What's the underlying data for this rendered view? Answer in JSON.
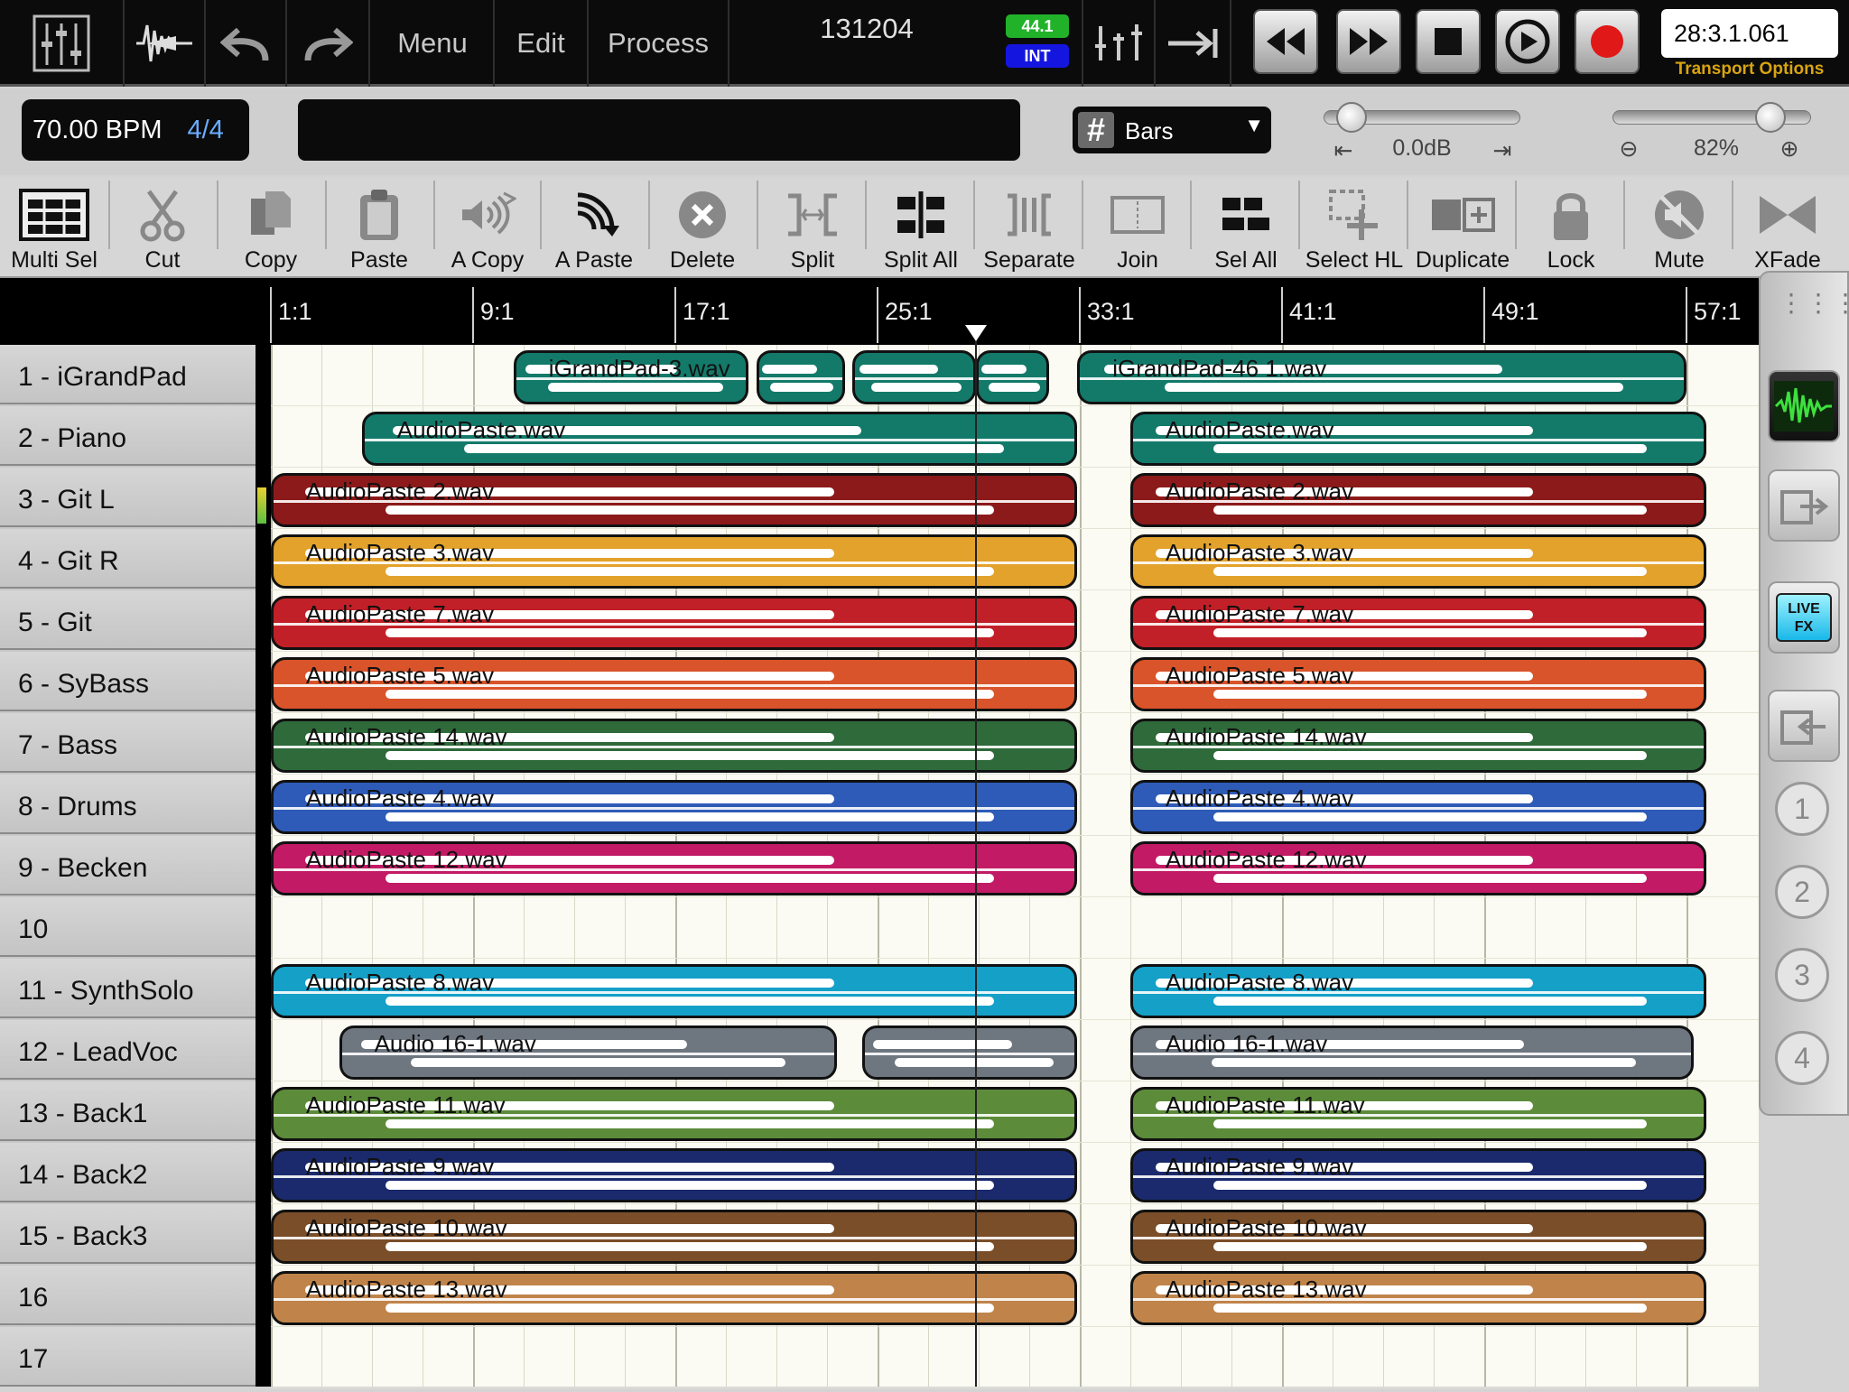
{
  "topbar": {
    "menus": [
      "Menu",
      "Edit",
      "Process"
    ],
    "project_name": "131204",
    "sample_rate": "44.1",
    "clock_source": "INT",
    "time_display": "28:3.1.061",
    "transport_options": "Transport Options",
    "icons": [
      "mixer-icon",
      "waveform-icon",
      "undo-icon",
      "redo-icon",
      "metronome-icon",
      "punch-icon",
      "rewind-icon",
      "fast-forward-icon",
      "stop-icon",
      "loop-icon",
      "record-icon"
    ],
    "record_color": "#e01818"
  },
  "secondbar": {
    "tempo": "70.00 BPM",
    "time_signature": "4/4",
    "grid_mode": "Bars",
    "volume": "0.0dB",
    "zoom": "82%"
  },
  "toolbar": [
    {
      "label": "Multi Sel",
      "icon": "multi-select-icon"
    },
    {
      "label": "Cut",
      "icon": "scissors-icon"
    },
    {
      "label": "Copy",
      "icon": "copy-icon"
    },
    {
      "label": "Paste",
      "icon": "clipboard-icon"
    },
    {
      "label": "A Copy",
      "icon": "audio-copy-icon"
    },
    {
      "label": "A Paste",
      "icon": "audio-paste-icon"
    },
    {
      "label": "Delete",
      "icon": "delete-icon"
    },
    {
      "label": "Split",
      "icon": "split-icon"
    },
    {
      "label": "Split All",
      "icon": "split-all-icon"
    },
    {
      "label": "Separate",
      "icon": "separate-icon"
    },
    {
      "label": "Join",
      "icon": "join-icon"
    },
    {
      "label": "Sel All",
      "icon": "select-all-icon"
    },
    {
      "label": "Select HL",
      "icon": "select-hl-icon"
    },
    {
      "label": "Duplicate",
      "icon": "duplicate-icon"
    },
    {
      "label": "Lock",
      "icon": "lock-icon"
    },
    {
      "label": "Mute",
      "icon": "mute-icon"
    },
    {
      "label": "XFade",
      "icon": "crossfade-icon"
    }
  ],
  "ruler": [
    "1:1",
    "9:1",
    "17:1",
    "25:1",
    "33:1",
    "41:1",
    "49:1",
    "57:1"
  ],
  "tracks": [
    "1 - iGrandPad",
    "2 - Piano",
    "3 - Git L",
    "4 - Git R",
    "5 - Git",
    "6 - SyBass",
    "7 - Bass",
    "8 - Drums",
    "9 - Becken",
    "10",
    "11 - SynthSolo",
    "12 - LeadVoc",
    "13 - Back1",
    "14 - Back2",
    "15 - Back3",
    "16",
    "17"
  ],
  "clips": [
    {
      "track": 0,
      "start_bar": 10.6,
      "end_bar": 19.9,
      "name": "iGrandPad-3.wav",
      "color": "#137a6a"
    },
    {
      "track": 0,
      "start_bar": 20.2,
      "end_bar": 23.7,
      "name": "",
      "color": "#137a6a"
    },
    {
      "track": 0,
      "start_bar": 24.0,
      "end_bar": 28.9,
      "name": "",
      "color": "#137a6a"
    },
    {
      "track": 0,
      "start_bar": 28.9,
      "end_bar": 31.8,
      "name": "",
      "color": "#137a6a"
    },
    {
      "track": 0,
      "start_bar": 32.9,
      "end_bar": 57.0,
      "name": "iGrandPad-46 1.wav",
      "color": "#137a6a"
    },
    {
      "track": 1,
      "start_bar": 4.6,
      "end_bar": 32.9,
      "name": "AudioPaste.wav",
      "color": "#137a6a"
    },
    {
      "track": 1,
      "start_bar": 35.0,
      "end_bar": 57.8,
      "name": "AudioPaste.wav",
      "color": "#137a6a"
    },
    {
      "track": 2,
      "start_bar": 1.0,
      "end_bar": 32.9,
      "name": "AudioPaste 2.wav",
      "color": "#8c1a1a"
    },
    {
      "track": 2,
      "start_bar": 35.0,
      "end_bar": 57.8,
      "name": "AudioPaste 2.wav",
      "color": "#8c1a1a"
    },
    {
      "track": 3,
      "start_bar": 1.0,
      "end_bar": 32.9,
      "name": "AudioPaste 3.wav",
      "color": "#e2a22c"
    },
    {
      "track": 3,
      "start_bar": 35.0,
      "end_bar": 57.8,
      "name": "AudioPaste 3.wav",
      "color": "#e2a22c"
    },
    {
      "track": 4,
      "start_bar": 1.0,
      "end_bar": 32.9,
      "name": "AudioPaste 7.wav",
      "color": "#c22028"
    },
    {
      "track": 4,
      "start_bar": 35.0,
      "end_bar": 57.8,
      "name": "AudioPaste 7.wav",
      "color": "#c22028"
    },
    {
      "track": 5,
      "start_bar": 1.0,
      "end_bar": 32.9,
      "name": "AudioPaste 5.wav",
      "color": "#d9542a"
    },
    {
      "track": 5,
      "start_bar": 35.0,
      "end_bar": 57.8,
      "name": "AudioPaste 5.wav",
      "color": "#d9542a"
    },
    {
      "track": 6,
      "start_bar": 1.0,
      "end_bar": 32.9,
      "name": "AudioPaste 14.wav",
      "color": "#2e6a3a"
    },
    {
      "track": 6,
      "start_bar": 35.0,
      "end_bar": 57.8,
      "name": "AudioPaste 14.wav",
      "color": "#2e6a3a"
    },
    {
      "track": 7,
      "start_bar": 1.0,
      "end_bar": 32.9,
      "name": "AudioPaste 4.wav",
      "color": "#2e5bb8"
    },
    {
      "track": 7,
      "start_bar": 35.0,
      "end_bar": 57.8,
      "name": "AudioPaste 4.wav",
      "color": "#2e5bb8"
    },
    {
      "track": 8,
      "start_bar": 1.0,
      "end_bar": 32.9,
      "name": "AudioPaste 12.wav",
      "color": "#c21a64"
    },
    {
      "track": 8,
      "start_bar": 35.0,
      "end_bar": 57.8,
      "name": "AudioPaste 12.wav",
      "color": "#c21a64"
    },
    {
      "track": 10,
      "start_bar": 1.0,
      "end_bar": 32.9,
      "name": "AudioPaste 8.wav",
      "color": "#15a0c8"
    },
    {
      "track": 10,
      "start_bar": 35.0,
      "end_bar": 57.8,
      "name": "AudioPaste 8.wav",
      "color": "#15a0c8"
    },
    {
      "track": 11,
      "start_bar": 3.7,
      "end_bar": 23.4,
      "name": "Audio 16-1.wav",
      "color": "#6e7680"
    },
    {
      "track": 11,
      "start_bar": 24.4,
      "end_bar": 32.9,
      "name": "",
      "color": "#6e7680"
    },
    {
      "track": 11,
      "start_bar": 35.0,
      "end_bar": 57.3,
      "name": "Audio 16-1.wav",
      "color": "#6e7680"
    },
    {
      "track": 12,
      "start_bar": 1.0,
      "end_bar": 32.9,
      "name": "AudioPaste 11.wav",
      "color": "#5c8c3a"
    },
    {
      "track": 12,
      "start_bar": 35.0,
      "end_bar": 57.8,
      "name": "AudioPaste 11.wav",
      "color": "#5c8c3a"
    },
    {
      "track": 13,
      "start_bar": 1.0,
      "end_bar": 32.9,
      "name": "AudioPaste 9.wav",
      "color": "#1a2a6c"
    },
    {
      "track": 13,
      "start_bar": 35.0,
      "end_bar": 57.8,
      "name": "AudioPaste 9.wav",
      "color": "#1a2a6c"
    },
    {
      "track": 14,
      "start_bar": 1.0,
      "end_bar": 32.9,
      "name": "AudioPaste 10.wav",
      "color": "#7a4e28"
    },
    {
      "track": 14,
      "start_bar": 35.0,
      "end_bar": 57.8,
      "name": "AudioPaste 10.wav",
      "color": "#7a4e28"
    },
    {
      "track": 15,
      "start_bar": 1.0,
      "end_bar": 32.9,
      "name": "AudioPaste 13.wav",
      "color": "#c0844a"
    },
    {
      "track": 15,
      "start_bar": 35.0,
      "end_bar": 57.8,
      "name": "AudioPaste 13.wav",
      "color": "#c0844a"
    }
  ],
  "playhead_bar": 28.9,
  "right_panel": {
    "buttons": [
      "waveform-editor-icon",
      "export-icon",
      "live-fx-icon",
      "import-icon"
    ],
    "live_fx_label": "LIVE FX",
    "numbers": [
      "1",
      "2",
      "3",
      "4"
    ]
  }
}
